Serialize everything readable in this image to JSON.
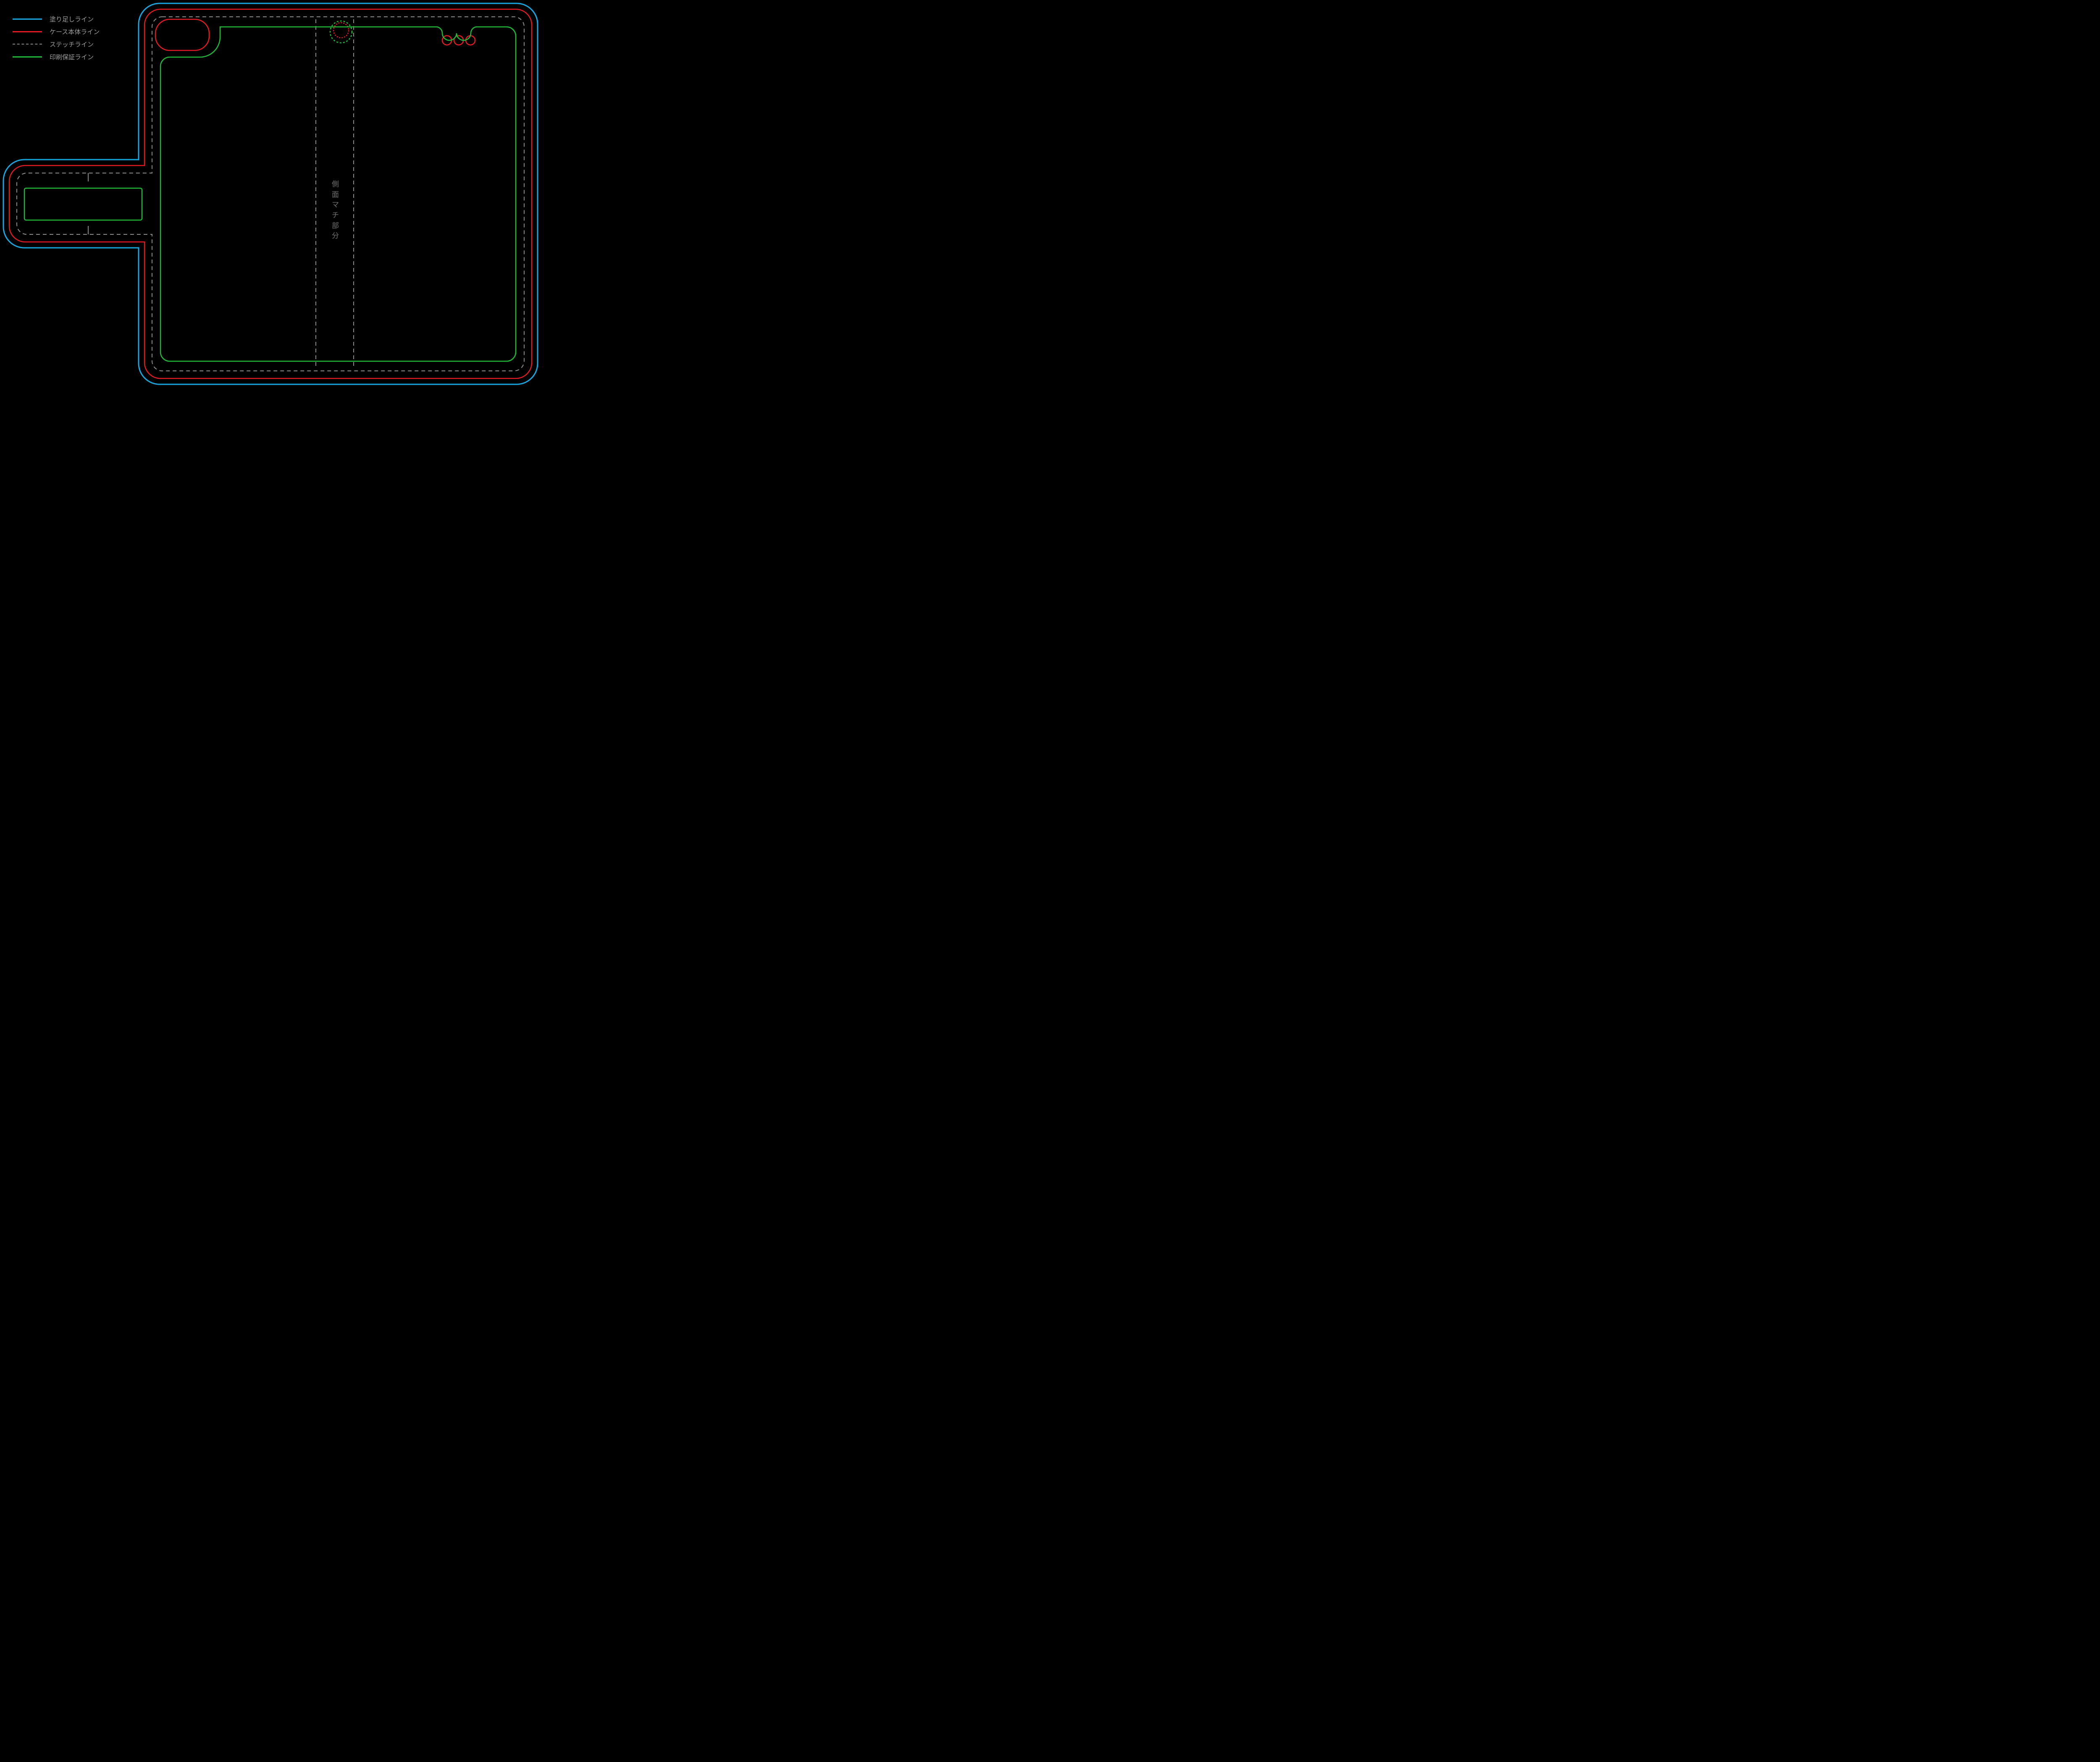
{
  "colors": {
    "bleed": "#17a6e0",
    "body": "#e41b23",
    "stitch": "#8a8a8a",
    "print": "#1fba3a",
    "label": "#9e9e9e",
    "gusset": "#707070"
  },
  "legend": [
    {
      "key": "bleed",
      "style": "solid",
      "label": "塗り足しライン"
    },
    {
      "key": "body",
      "style": "solid",
      "label": "ケース本体ライン"
    },
    {
      "key": "stitch",
      "style": "dash",
      "label": "ステッチライン"
    },
    {
      "key": "print",
      "style": "solid",
      "label": "印刷保証ライン"
    }
  ],
  "gusset_label": [
    "側",
    "面",
    "マ",
    "チ",
    "部",
    "分"
  ],
  "geometry_note": "Folio phone-case die-line template. Main rounded rectangle body ~935×905 with clasp tab on left side (~305 wide, ~200 tall). Camera cutout top-left, lens circle top-centre-right, strap holes top-right. Four concentric outlines: cyan bleed (outermost), red case body, grey dashed stitch, green print-safe (innermost). Two grey dashed vertical fold/gusset guides inside."
}
